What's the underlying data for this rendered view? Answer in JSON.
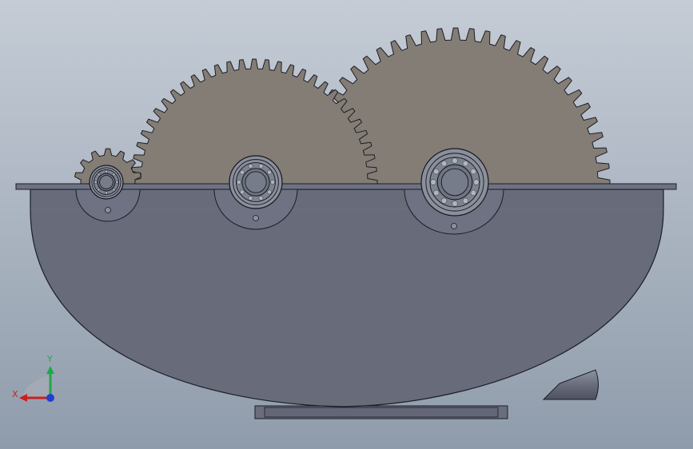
{
  "viewport": {
    "background_top": "#c5ccd6",
    "background_bottom": "#8f9cab"
  },
  "model": {
    "housing_color": "#676b7a",
    "flange_color": "#6e7282",
    "gear_color": "#847d75",
    "bearing_color": "#8a8f9b",
    "gears": [
      {
        "name": "pinion-gear",
        "teeth": 14
      },
      {
        "name": "middle-gear",
        "teeth": 60
      },
      {
        "name": "large-gear",
        "teeth": 60
      }
    ]
  },
  "triad": {
    "x_label": "X",
    "y_label": "Y",
    "x_color": "#cc1f1f",
    "y_color": "#1fa84a",
    "z_color": "#1f3fd0"
  }
}
